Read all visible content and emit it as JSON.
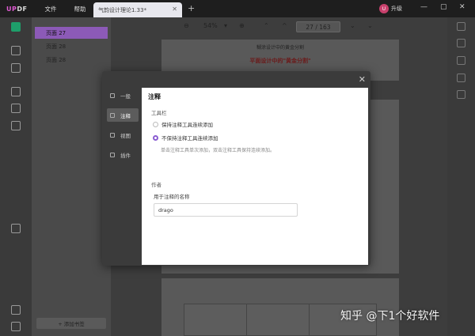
{
  "app": {
    "logo_prefix": "UP",
    "logo_suffix": "DF",
    "menu": [
      "文件",
      "帮助"
    ],
    "tab_title": "气韵设计理论1.33*",
    "upgrade_label": "升级",
    "avatar_initial": "U"
  },
  "toolbar": {
    "zoom": "54%",
    "page_current": "27",
    "page_total": "163"
  },
  "bookmarks": {
    "items": [
      "页面 27",
      "页面 28",
      "页面 28"
    ],
    "add_label": "+ 添加书签"
  },
  "document": {
    "page_header": "糊涂设计中的黄金分割",
    "page_heading": "平面设计中的\"黄金分割\""
  },
  "dialog": {
    "nav": [
      {
        "label": "一般"
      },
      {
        "label": "注释"
      },
      {
        "label": "视图"
      },
      {
        "label": "插件"
      }
    ],
    "title": "注释",
    "section_toolbar": "工具栏",
    "option_keep": "保持注释工具连续添加",
    "option_no_keep": "不保持注释工具连续添加",
    "hint": "单击注释工具单次添加，双击注释工具保持连续添加。",
    "section_author": "作者",
    "author_label": "用于注释的名称",
    "author_value": "drago"
  },
  "watermark": "知乎 @下1个好软件",
  "colors": {
    "accent": "#8a5cd1",
    "bookmark_active": "#8c5ab7",
    "brand_green": "#1e9e6a"
  }
}
